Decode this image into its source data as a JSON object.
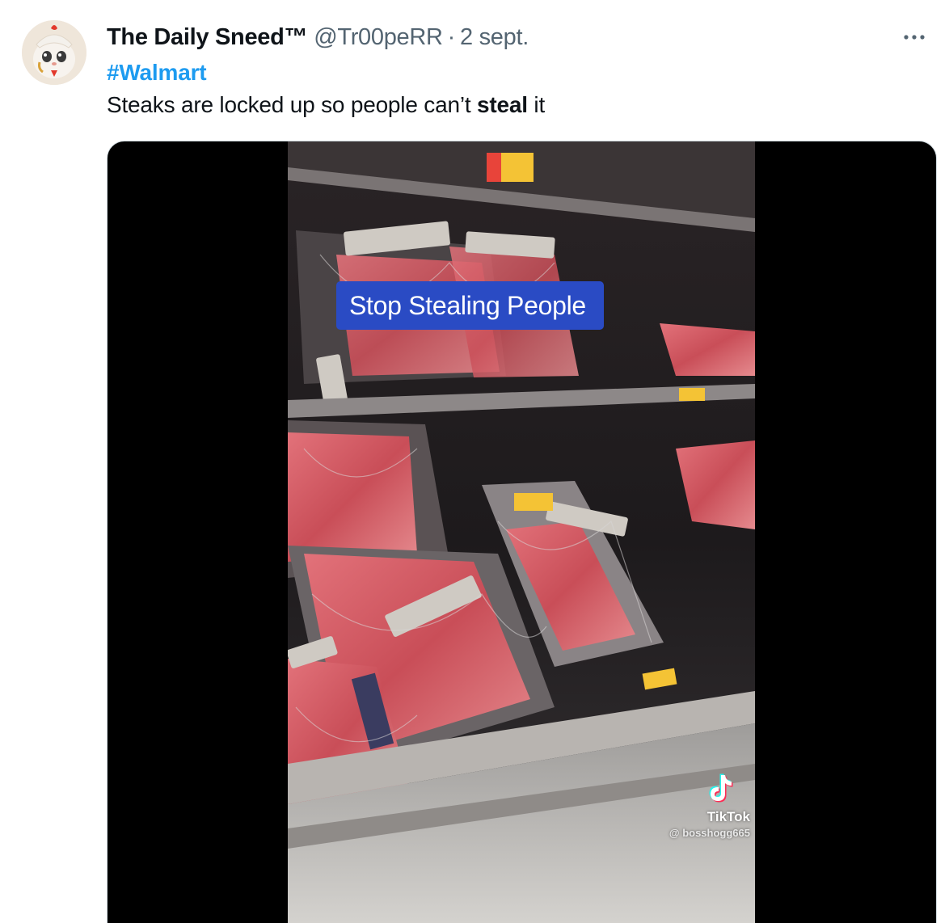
{
  "tweet": {
    "display_name": "The Daily Sneed™",
    "handle": "@Tr00peRR",
    "separator": "·",
    "date": "2 sept.",
    "more_icon": "more-horizontal-icon",
    "hashtag": "#Walmart",
    "text_before": "Steaks are locked up so people can’t ",
    "text_bold": "steal",
    "text_after": " it"
  },
  "media": {
    "caption": "Stop Stealing People",
    "watermark_brand": "TikTok",
    "watermark_user": "@ bosshogg665",
    "watermark_icon": "tiktok-icon"
  },
  "colors": {
    "link": "#1d9bf0",
    "secondary_text": "#536471",
    "caption_bg": "#2a4bc4"
  }
}
